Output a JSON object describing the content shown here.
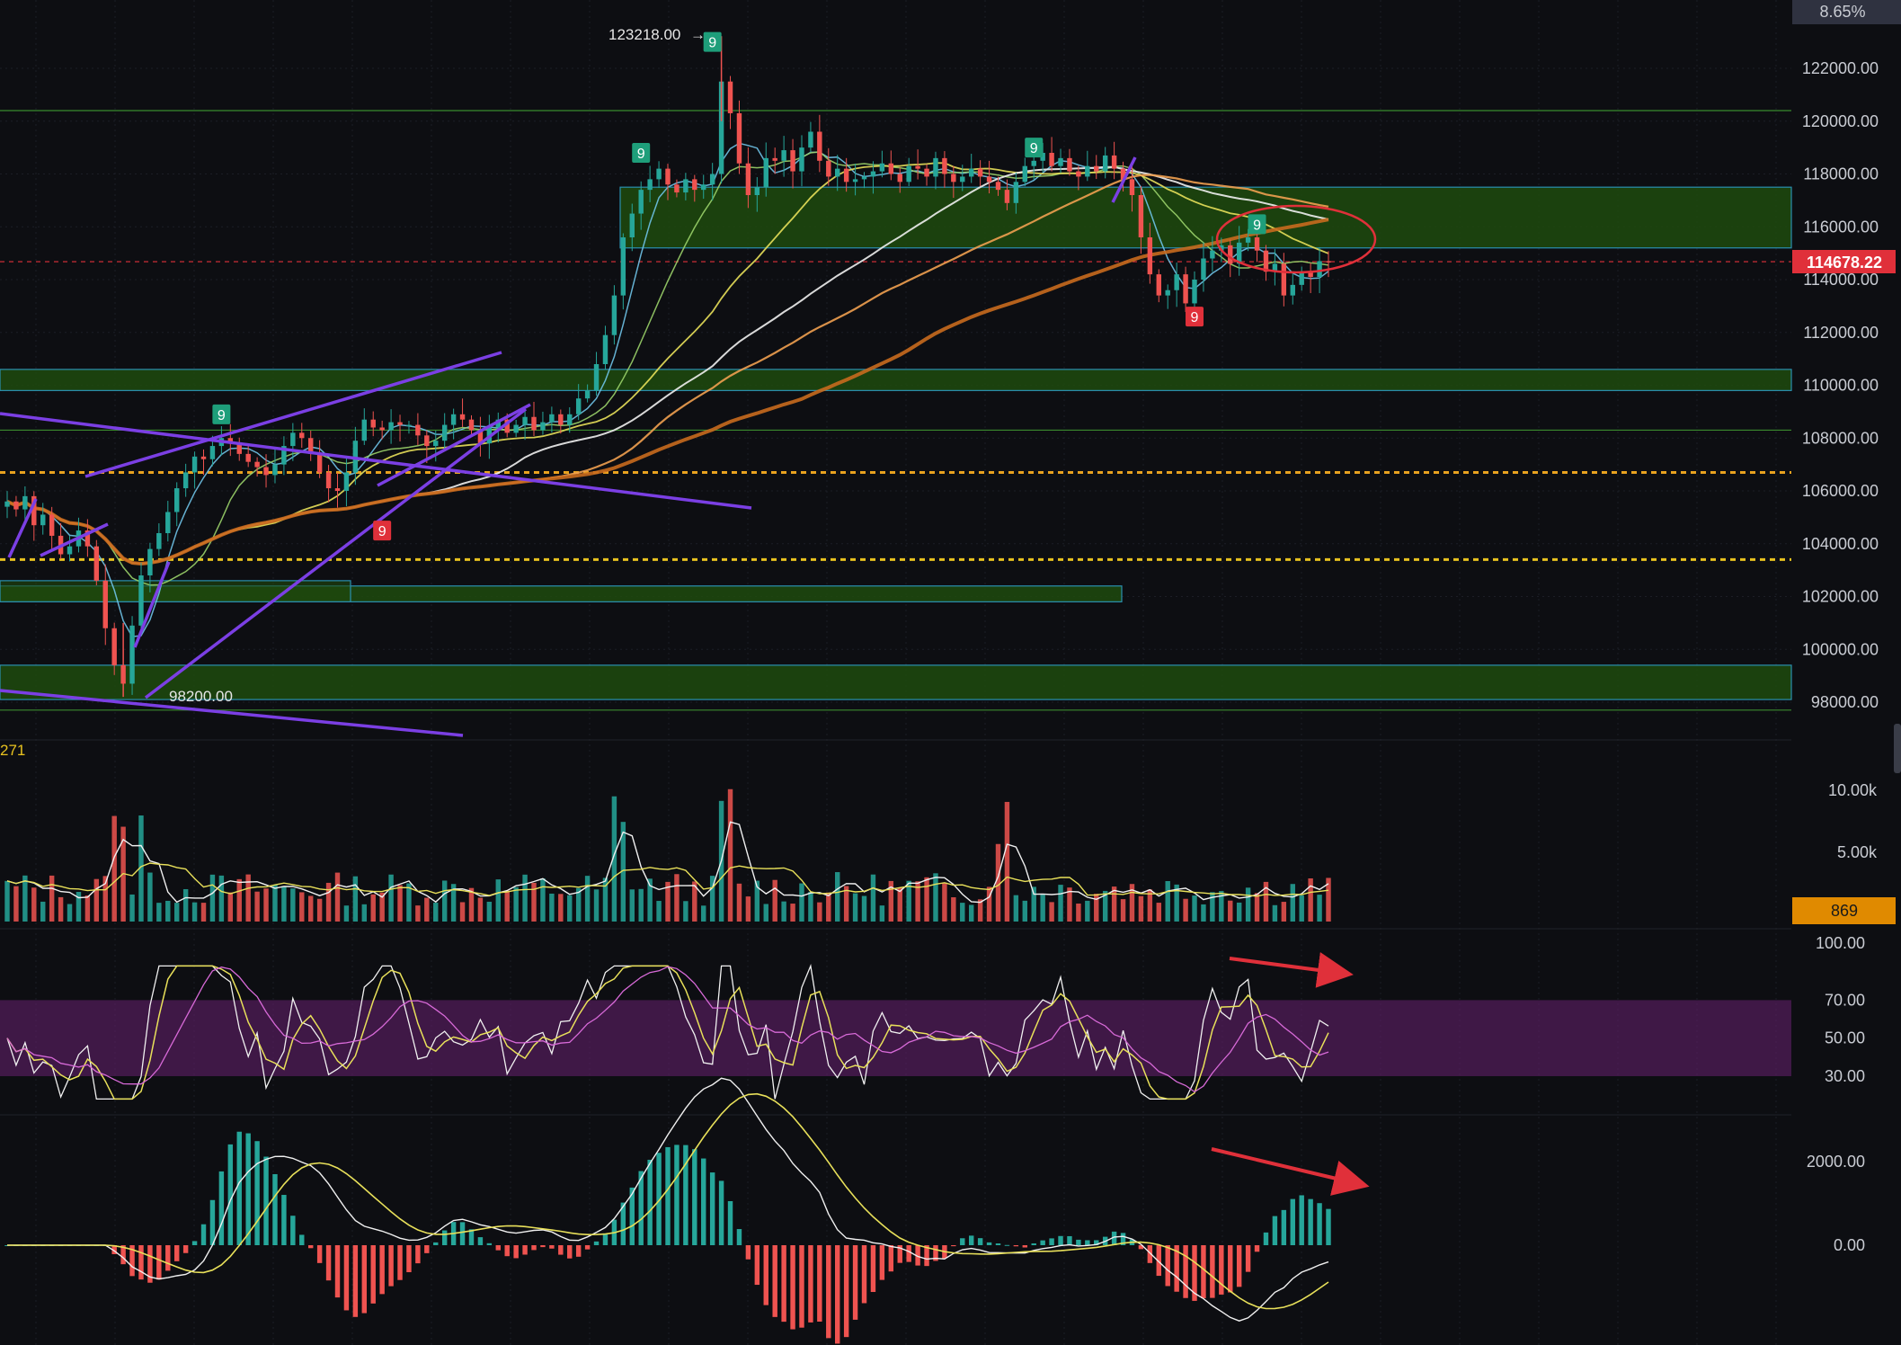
{
  "top_badge": "8.65%",
  "chart_data": {
    "type": "candlestick",
    "price_axis": {
      "ticks": [
        "122000.00",
        "120000.00",
        "118000.00",
        "116000.00",
        "114000.00",
        "112000.00",
        "110000.00",
        "108000.00",
        "106000.00",
        "104000.00",
        "102000.00",
        "100000.00",
        "98000.00"
      ],
      "values": [
        122000,
        120000,
        118000,
        116000,
        114000,
        112000,
        110000,
        108000,
        106000,
        104000,
        102000,
        100000,
        98000
      ],
      "range": [
        97000,
        124000
      ]
    },
    "current_price": "114678.22",
    "current_price_value": 114678.22,
    "high_label": "123218.00",
    "high_value": 123218,
    "low_label": "98200.00",
    "low_value": 98200,
    "side_label": "271",
    "price_zones": [
      {
        "from": 115200,
        "to": 117500
      },
      {
        "from": 109800,
        "to": 110600
      },
      {
        "from": 101800,
        "to": 102400
      },
      {
        "from": 98100,
        "to": 99400
      }
    ],
    "horizontal_lines": [
      {
        "value": 120400,
        "style": "solid",
        "color": "#3a8a2e"
      },
      {
        "value": 108300,
        "style": "solid",
        "color": "#3a8a2e"
      },
      {
        "value": 106700,
        "style": "dotted",
        "color": "#e8a21f"
      },
      {
        "value": 103400,
        "style": "dotted",
        "color": "#e8c21f"
      },
      {
        "value": 97700,
        "style": "solid",
        "color": "#3a8a2e"
      }
    ],
    "td_markers": [
      {
        "label": "9",
        "type": "sell",
        "x_index": 24,
        "value": 108900
      },
      {
        "label": "9",
        "type": "buy",
        "x_index": 42,
        "value": 104500
      },
      {
        "label": "9",
        "type": "sell",
        "x_index": 71,
        "value": 118800
      },
      {
        "label": "9",
        "type": "sell",
        "x_index": 79,
        "value": 123000
      },
      {
        "label": "9",
        "type": "sell",
        "x_index": 115,
        "value": 119000
      },
      {
        "label": "9",
        "type": "buy",
        "x_index": 133,
        "value": 112600
      },
      {
        "label": "9",
        "type": "sell",
        "x_index": 140,
        "value": 116100
      }
    ],
    "candles_close": [
      105600,
      105300,
      105800,
      104700,
      105100,
      104300,
      103600,
      103900,
      104500,
      103900,
      102600,
      100800,
      99400,
      98700,
      100900,
      102800,
      103800,
      104400,
      105200,
      106100,
      106700,
      107300,
      107200,
      107700,
      108000,
      107800,
      107400,
      107100,
      106900,
      106600,
      107000,
      107700,
      108200,
      108000,
      107400,
      106700,
      106100,
      106000,
      106700,
      107900,
      108700,
      108400,
      108300,
      108600,
      108500,
      108500,
      108100,
      107700,
      107900,
      108500,
      108900,
      108700,
      108300,
      107800,
      108400,
      108700,
      108200,
      108500,
      108800,
      108300,
      108600,
      108900,
      108500,
      108900,
      109500,
      109800,
      110800,
      111900,
      113400,
      115600,
      116500,
      117400,
      117800,
      118200,
      117600,
      117300,
      117800,
      117400,
      117600,
      118000,
      121500,
      120300,
      118400,
      117200,
      117500,
      118600,
      118500,
      118900,
      118100,
      119000,
      119600,
      118500,
      117900,
      118200,
      117700,
      117800,
      117900,
      118100,
      118400,
      118000,
      117700,
      118300,
      118200,
      117900,
      118600,
      118000,
      117700,
      117900,
      118200,
      117900,
      117700,
      117400,
      116900,
      117700,
      118300,
      118500,
      118800,
      118300,
      118600,
      118100,
      117900,
      118300,
      118100,
      118700,
      118200,
      117800,
      117200,
      115600,
      114200,
      113400,
      113600,
      114200,
      113100,
      114000,
      114800,
      115100,
      115300,
      114600,
      115400,
      115600,
      115100,
      114300,
      114600,
      113400,
      113800,
      114300,
      114100,
      114700,
      114678
    ],
    "volume_axis": {
      "ticks": [
        "10.00k",
        "5.00k"
      ],
      "values": [
        10000,
        5000
      ],
      "current": "869",
      "current_value": 869
    },
    "rsi_axis": {
      "ticks": [
        "100.00",
        "70.00",
        "50.00",
        "30.00"
      ],
      "values": [
        100,
        70,
        50,
        30
      ]
    },
    "macd_axis": {
      "ticks": [
        "2000.00",
        "0.00"
      ],
      "values": [
        2000,
        0
      ]
    }
  }
}
